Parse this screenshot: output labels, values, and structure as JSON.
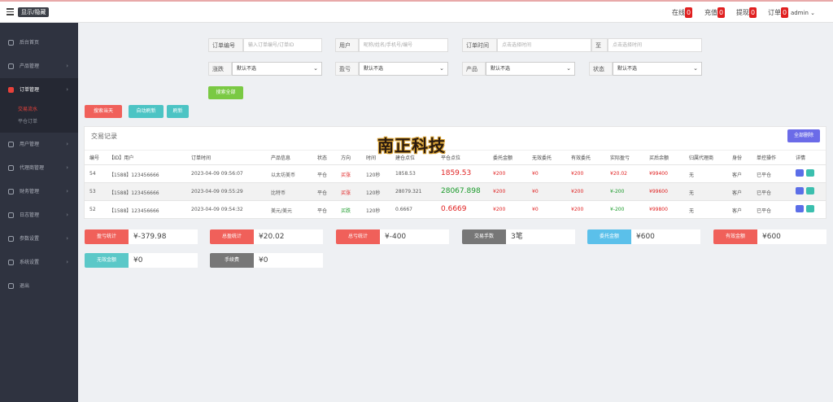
{
  "header": {
    "toggle_label": "显示/隐藏",
    "stats": [
      {
        "label": "在线",
        "count": "0"
      },
      {
        "label": "充值",
        "count": "0"
      },
      {
        "label": "提现",
        "count": "0"
      },
      {
        "label": "订单",
        "count": "0"
      }
    ],
    "user": "admin"
  },
  "sidebar": {
    "items": [
      {
        "label": "后台首页"
      },
      {
        "label": "产品管理"
      },
      {
        "label": "订单管理"
      },
      {
        "label": "用户管理"
      },
      {
        "label": "代理商管理"
      },
      {
        "label": "财务管理"
      },
      {
        "label": "日志管理"
      },
      {
        "label": "参数设置"
      },
      {
        "label": "系统设置"
      },
      {
        "label": "退出"
      }
    ],
    "subitems": [
      {
        "label": "交易流水"
      },
      {
        "label": "平仓订单"
      }
    ]
  },
  "filters": {
    "order_no_label": "订单编号",
    "order_no_placeholder": "输入订单编号/订单ID",
    "user_label": "用户",
    "user_placeholder": "昵称/姓名/手机号/编号",
    "time_label": "订单时间",
    "time_placeholder": "点击选择时间",
    "to_label": "至",
    "to_placeholder": "点击选择时间",
    "updown_label": "涨跌",
    "updown_value": "默认不选",
    "profit_label": "盈亏",
    "profit_value": "默认不选",
    "product_label": "产品",
    "product_value": "默认不选",
    "status_label": "状态",
    "status_value": "默认不选",
    "search_all": "搜索全部"
  },
  "actions": {
    "search_today": "搜索当天",
    "auto_refresh": "自动刷新",
    "refresh": "刷新",
    "export": "全部删除"
  },
  "panel": {
    "title": "交易记录",
    "columns": [
      "编号",
      "【ID】用户",
      "订单时间",
      "产品信息",
      "状态",
      "方向",
      "时间",
      "建仓点位",
      "平仓点位",
      "委托金额",
      "无效委托",
      "有效委托",
      "实际盈亏",
      "买后余额",
      "归属代理商",
      "身份",
      "单控操作",
      "详情"
    ],
    "rows": [
      {
        "id": "54",
        "user": "【1588】123456666",
        "time": "2023-04-09 09:56:07",
        "product": "以太坊美币",
        "status": "平仓",
        "direction": "买涨",
        "dir_color": "red",
        "period": "120秒",
        "open": "1858.53",
        "close": "1859.53",
        "close_color": "red",
        "amount": "¥200",
        "invalid": "¥0",
        "valid": "¥200",
        "pnl": "¥20.02",
        "pnl_color": "red",
        "balance": "¥99400",
        "agent": "无",
        "role": "客户",
        "op": "已平仓"
      },
      {
        "id": "53",
        "user": "【1588】123456666",
        "time": "2023-04-09 09:55:29",
        "product": "比特币",
        "status": "平仓",
        "direction": "买涨",
        "dir_color": "red",
        "period": "120秒",
        "open": "28079.321",
        "close": "28067.898",
        "close_color": "green",
        "amount": "¥200",
        "invalid": "¥0",
        "valid": "¥200",
        "pnl": "¥-200",
        "pnl_color": "green",
        "balance": "¥99600",
        "agent": "无",
        "role": "客户",
        "op": "已平仓"
      },
      {
        "id": "52",
        "user": "【1588】123456666",
        "time": "2023-04-09 09:54:32",
        "product": "美元/美元",
        "status": "平仓",
        "direction": "买跌",
        "dir_color": "green",
        "period": "120秒",
        "open": "0.6667",
        "close": "0.6669",
        "close_color": "red",
        "amount": "¥200",
        "invalid": "¥0",
        "valid": "¥200",
        "pnl": "¥-200",
        "pnl_color": "green",
        "balance": "¥99800",
        "agent": "无",
        "role": "客户",
        "op": "已平仓"
      }
    ]
  },
  "summary": [
    {
      "label": "盈亏统计",
      "value": "¥-379.98",
      "color": "#f0605a"
    },
    {
      "label": "总盈统计",
      "value": "¥20.02",
      "color": "#f0605a"
    },
    {
      "label": "总亏统计",
      "value": "¥-400",
      "color": "#f0605a"
    },
    {
      "label": "交易手数",
      "value": "3笔",
      "color": "#777777"
    },
    {
      "label": "委托金额",
      "value": "¥600",
      "color": "#5bc0ea"
    },
    {
      "label": "有效金额",
      "value": "¥600",
      "color": "#f0605a"
    },
    {
      "label": "无效金额",
      "value": "¥0",
      "color": "#5bc8c8"
    },
    {
      "label": "手续费",
      "value": "¥0",
      "color": "#777777"
    }
  ],
  "logo_text": "南正科技",
  "colors": {
    "sidebar": "#2f3340",
    "accent_red": "#e8413a",
    "btn_green": "#7ac943",
    "btn_teal": "#4cc4c4",
    "btn_blue": "#6b6be8",
    "btn_red": "#f0605a"
  }
}
